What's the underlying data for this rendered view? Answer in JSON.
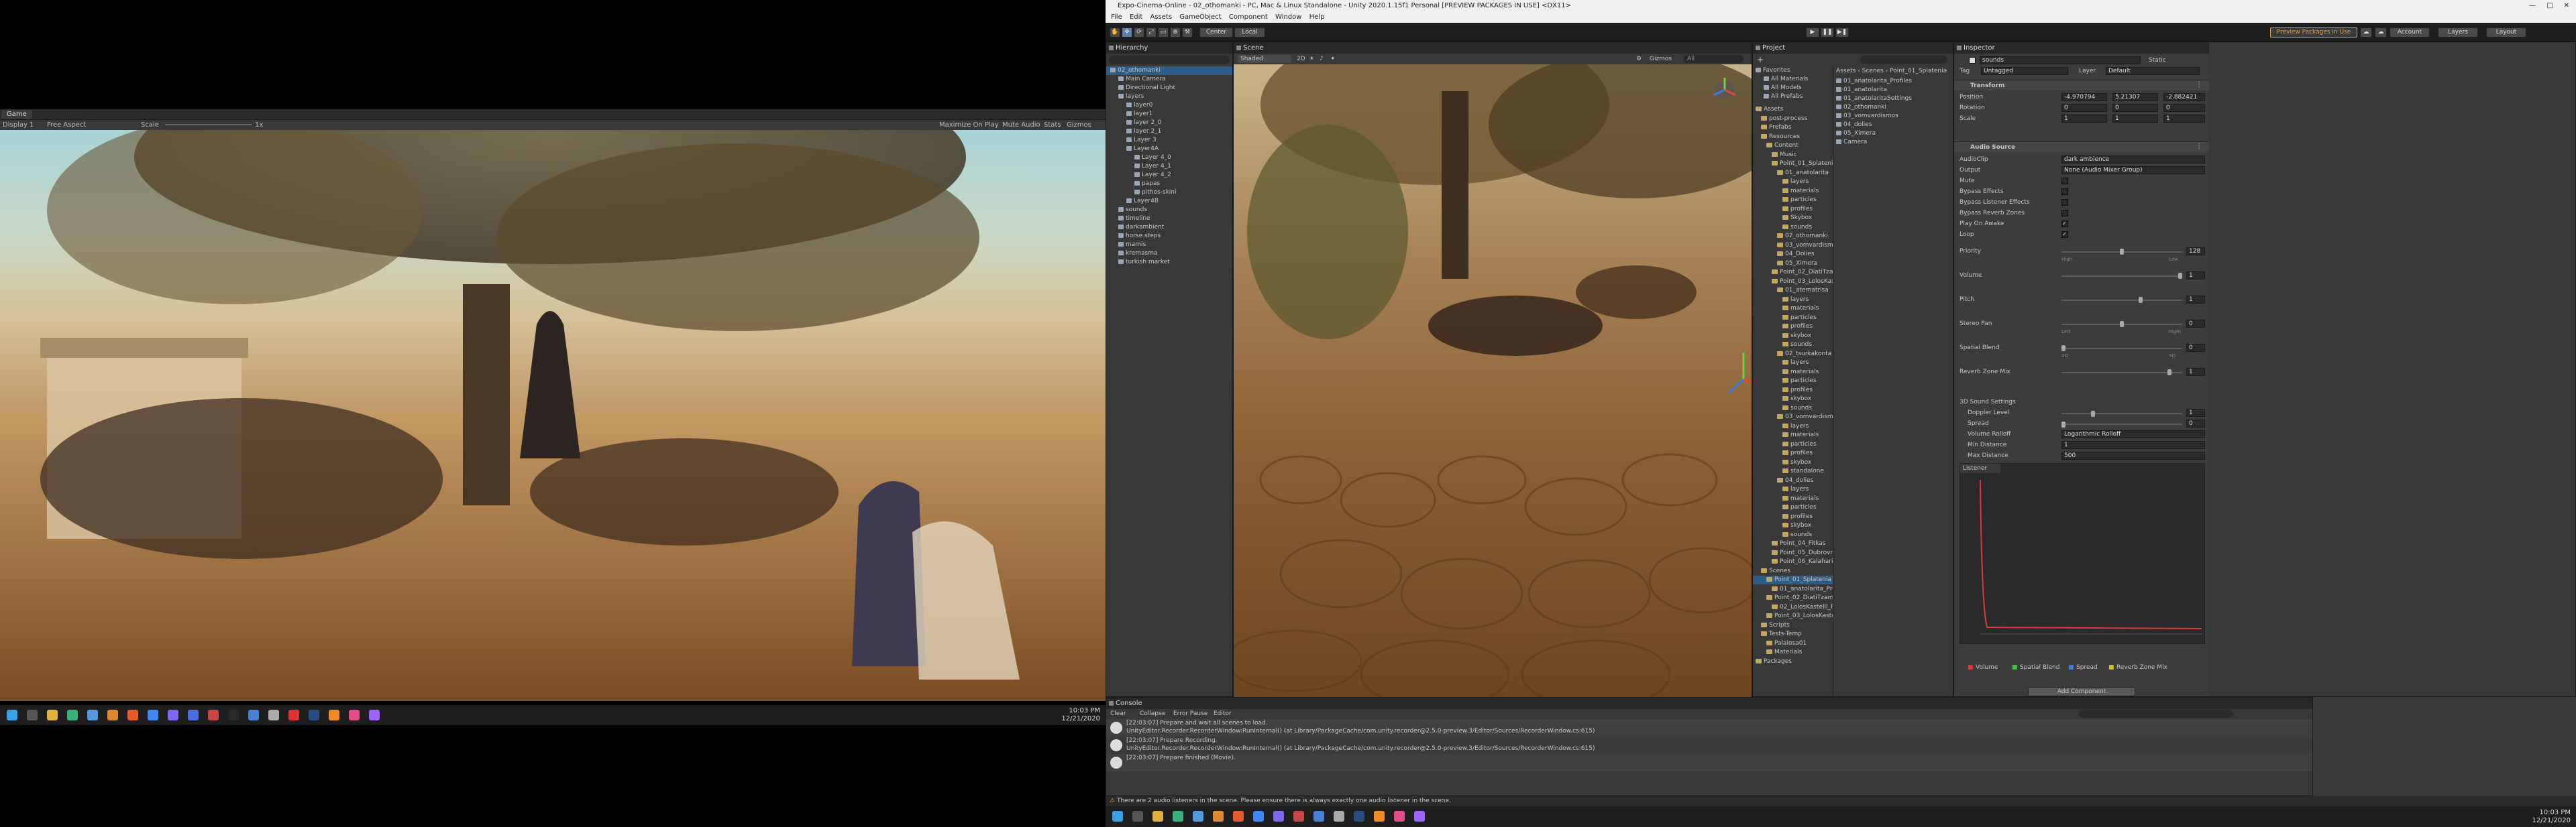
{
  "game": {
    "tab": "Game",
    "display": "Display 1",
    "aspect": "Free Aspect",
    "scale_label": "Scale",
    "scale_value": "1x",
    "maximize": "Maximize On Play",
    "mute": "Mute Audio",
    "stats": "Stats",
    "gizmos": "Gizmos"
  },
  "taskbar_left": {
    "time": "10:03 PM",
    "date": "12/21/2020"
  },
  "taskbar_right": {
    "time": "10:03 PM",
    "date": "12/21/2020"
  },
  "editor": {
    "title": "Expo-Cinema-Online - 02_othomanki - PC, Mac & Linux Standalone - Unity 2020.1.15f1 Personal [PREVIEW PACKAGES IN USE] <DX11>",
    "menu": [
      "File",
      "Edit",
      "Assets",
      "GameObject",
      "Component",
      "Window",
      "Help"
    ],
    "toolbar": {
      "center": "Center",
      "local": "Local",
      "preview_packages": "Preview Packages in Use",
      "account": "Account",
      "layers": "Layers",
      "layout": "Layout"
    }
  },
  "hierarchy": {
    "tab": "Hierarchy",
    "items": [
      {
        "label": "02_othomanki",
        "depth": 0,
        "selected": true
      },
      {
        "label": "Main Camera",
        "depth": 1
      },
      {
        "label": "Directional Light",
        "depth": 1
      },
      {
        "label": "layers",
        "depth": 1
      },
      {
        "label": "layer0",
        "depth": 2
      },
      {
        "label": "layer1",
        "depth": 2
      },
      {
        "label": "layer 2_0",
        "depth": 2
      },
      {
        "label": "layer 2_1",
        "depth": 2
      },
      {
        "label": "Layer 3",
        "depth": 2
      },
      {
        "label": "Layer4A",
        "depth": 2
      },
      {
        "label": "Layer 4_0",
        "depth": 3
      },
      {
        "label": "Layer 4_1",
        "depth": 3
      },
      {
        "label": "Layer 4_2",
        "depth": 3
      },
      {
        "label": "papas",
        "depth": 3
      },
      {
        "label": "pithos-skini",
        "depth": 3
      },
      {
        "label": "Layer4B",
        "depth": 2
      },
      {
        "label": "sounds",
        "depth": 1
      },
      {
        "label": "timeline",
        "depth": 1
      },
      {
        "label": "darkambient",
        "depth": 1
      },
      {
        "label": "horse steps",
        "depth": 1
      },
      {
        "label": "mamis",
        "depth": 1
      },
      {
        "label": "kremasma",
        "depth": 1
      },
      {
        "label": "turkish market",
        "depth": 1
      }
    ]
  },
  "scene": {
    "tab": "Scene",
    "shading": "Shaded",
    "mode": "2D",
    "gizmos": "Gizmos",
    "search": "All"
  },
  "project": {
    "tab": "Project",
    "favorites": [
      "Favorites",
      "All Materials",
      "All Models",
      "All Prefabs"
    ],
    "tree": [
      {
        "label": "Assets",
        "depth": 0
      },
      {
        "label": "post-process",
        "depth": 1
      },
      {
        "label": "Prefabs",
        "depth": 1
      },
      {
        "label": "Resources",
        "depth": 1
      },
      {
        "label": "Content",
        "depth": 2
      },
      {
        "label": "Music",
        "depth": 3
      },
      {
        "label": "Point_01_Splatenia",
        "depth": 3
      },
      {
        "label": "01_anatolarita",
        "depth": 4
      },
      {
        "label": "layers",
        "depth": 5
      },
      {
        "label": "materials",
        "depth": 5
      },
      {
        "label": "particles",
        "depth": 5
      },
      {
        "label": "profiles",
        "depth": 5
      },
      {
        "label": "Skybox",
        "depth": 5
      },
      {
        "label": "sounds",
        "depth": 5
      },
      {
        "label": "02_othomanki",
        "depth": 4
      },
      {
        "label": "03_vomvardismos",
        "depth": 4
      },
      {
        "label": "04_Dolies",
        "depth": 4
      },
      {
        "label": "05_Ximera",
        "depth": 4
      },
      {
        "label": "Point_02_DiatiTzami",
        "depth": 3
      },
      {
        "label": "Point_03_LolosKastelli",
        "depth": 3
      },
      {
        "label": "01_atematrisa",
        "depth": 4
      },
      {
        "label": "layers",
        "depth": 5
      },
      {
        "label": "materials",
        "depth": 5
      },
      {
        "label": "particles",
        "depth": 5
      },
      {
        "label": "profiles",
        "depth": 5
      },
      {
        "label": "skybox",
        "depth": 5
      },
      {
        "label": "sounds",
        "depth": 5
      },
      {
        "label": "02_tsurkakonta",
        "depth": 4
      },
      {
        "label": "layers",
        "depth": 5
      },
      {
        "label": "materials",
        "depth": 5
      },
      {
        "label": "particles",
        "depth": 5
      },
      {
        "label": "profiles",
        "depth": 5
      },
      {
        "label": "skybox",
        "depth": 5
      },
      {
        "label": "sounds",
        "depth": 5
      },
      {
        "label": "03_vomvardismos",
        "depth": 4
      },
      {
        "label": "layers",
        "depth": 5
      },
      {
        "label": "materials",
        "depth": 5
      },
      {
        "label": "particles",
        "depth": 5
      },
      {
        "label": "profiles",
        "depth": 5
      },
      {
        "label": "skybox",
        "depth": 5
      },
      {
        "label": "standalone",
        "depth": 5
      },
      {
        "label": "04_dolies",
        "depth": 4
      },
      {
        "label": "layers",
        "depth": 5
      },
      {
        "label": "materials",
        "depth": 5
      },
      {
        "label": "particles",
        "depth": 5
      },
      {
        "label": "profiles",
        "depth": 5
      },
      {
        "label": "skybox",
        "depth": 5
      },
      {
        "label": "sounds",
        "depth": 5
      },
      {
        "label": "Point_04_Fitkas",
        "depth": 3
      },
      {
        "label": "Point_05_Dubrovn",
        "depth": 3
      },
      {
        "label": "Point_06_Kalahari",
        "depth": 3
      },
      {
        "label": "Scenes",
        "depth": 1
      },
      {
        "label": "Point_01_Splatenia",
        "depth": 2,
        "selected": true
      },
      {
        "label": "01_anatolarita_Profiles",
        "depth": 3
      },
      {
        "label": "Point_02_DiatiTzami",
        "depth": 2
      },
      {
        "label": "02_LolosKastelli_Profiles",
        "depth": 3
      },
      {
        "label": "Point_03_LolosKastell",
        "depth": 2
      },
      {
        "label": "Scripts",
        "depth": 1
      },
      {
        "label": "Tests-Temp",
        "depth": 1
      },
      {
        "label": "Palaiosa01",
        "depth": 2
      },
      {
        "label": "Materials",
        "depth": 2
      },
      {
        "label": "Packages",
        "depth": 0
      }
    ],
    "breadcrumb": [
      "Assets",
      "Scenes",
      "Point_01_Splatenia"
    ],
    "files": [
      "01_anatolarita_Profiles",
      "01_anatolarita",
      "01_anatolaritaSettings",
      "02_othomanki",
      "03_vomvardismos",
      "04_dolies",
      "05_Ximera",
      "Camera"
    ]
  },
  "inspector": {
    "tab": "Inspector",
    "object_name": "sounds",
    "static": "Static",
    "tag_label": "Tag",
    "tag": "Untagged",
    "layer_label": "Layer",
    "layer": "Default",
    "transform": "Transform",
    "position_label": "Position",
    "position": {
      "x": "-4.970794",
      "y": "5.21307",
      "z": "-2.882421"
    },
    "rotation_label": "Rotation",
    "rotation": {
      "x": "0",
      "y": "0",
      "z": "0"
    },
    "scale_label": "Scale",
    "scale": {
      "x": "1",
      "y": "1",
      "z": "1"
    },
    "audio_source": "Audio Source",
    "audio_clip_label": "AudioClip",
    "audio_clip": "dark ambience",
    "output_label": "Output",
    "output": "None (Audio Mixer Group)",
    "toggles": [
      {
        "label": "Mute",
        "checked": false
      },
      {
        "label": "Bypass Effects",
        "checked": false
      },
      {
        "label": "Bypass Listener Effects",
        "checked": false
      },
      {
        "label": "Bypass Reverb Zones",
        "checked": false
      },
      {
        "label": "Play On Awake",
        "checked": true
      },
      {
        "label": "Loop",
        "checked": true
      }
    ],
    "sliders": [
      {
        "label": "Priority",
        "value": "128",
        "pos": 0.5,
        "low": "High",
        "high": "Low"
      },
      {
        "label": "Volume",
        "value": "1",
        "pos": 1.0
      },
      {
        "label": "Pitch",
        "value": "1",
        "pos": 0.66
      },
      {
        "label": "Stereo Pan",
        "value": "0",
        "pos": 0.5,
        "low": "Left",
        "high": "Right"
      },
      {
        "label": "Spatial Blend",
        "value": "0",
        "pos": 0.0,
        "low": "2D",
        "high": "3D"
      },
      {
        "label": "Reverb Zone Mix",
        "value": "1",
        "pos": 0.91
      }
    ],
    "sound_settings": "3D Sound Settings",
    "doppler_label": "Doppler Level",
    "doppler": "1",
    "spread_label": "Spread",
    "spread": "0",
    "rolloff_label": "Volume Rolloff",
    "rolloff": "Logarithmic Rolloff",
    "min_dist_label": "Min Distance",
    "min_dist": "1",
    "max_dist_label": "Max Distance",
    "max_dist": "500",
    "graph_tab": "Listener",
    "legend": [
      "Volume",
      "Spatial Blend",
      "Spread",
      "Reverb Zone Mix"
    ],
    "add_component": "Add Component"
  },
  "console": {
    "tab": "Console",
    "buttons": [
      "Clear",
      "Collapse",
      "Error Pause",
      "Editor"
    ],
    "messages": [
      {
        "line1": "[22:03:07] Prepare and wait all scenes to load.",
        "line2": "UnityEditor.Recorder.RecorderWindow:RunInternal() (at Library/PackageCache/com.unity.recorder@2.5.0-preview.3/Editor/Sources/RecorderWindow.cs:615)"
      },
      {
        "line1": "[22:03:07] Prepare Recording.",
        "line2": "UnityEditor.Recorder.RecorderWindow:RunInternal() (at Library/PackageCache/com.unity.recorder@2.5.0-preview.3/Editor/Sources/RecorderWindow.cs:615)"
      },
      {
        "line1": "[22:03:07] Prepare finished (Movie).",
        "line2": ""
      }
    ],
    "status": "There are 2 audio listeners in the scene. Please ensure there is always exactly one audio listener in the scene."
  }
}
